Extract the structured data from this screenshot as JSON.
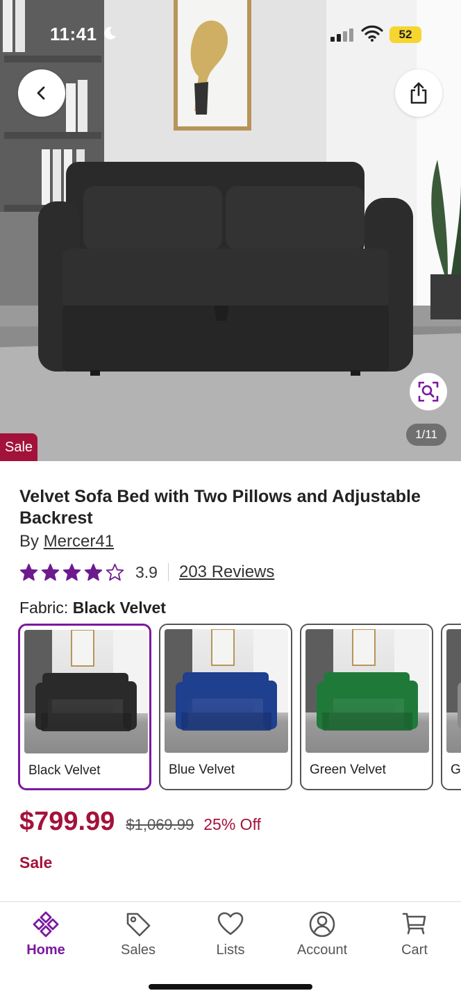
{
  "status_bar": {
    "time": "11:41",
    "battery": "52"
  },
  "hero": {
    "image_counter": "1/11",
    "sale_badge": "Sale"
  },
  "product": {
    "title": "Velvet Sofa Bed with Two Pillows and Adjustable Backrest",
    "by_prefix": "By",
    "brand": "Mercer41",
    "rating": 3.9,
    "rating_text": "3.9",
    "stars_filled": 4,
    "stars_total": 5,
    "reviews_link": "203 Reviews"
  },
  "fabric": {
    "label": "Fabric:",
    "selected": "Black Velvet",
    "options": [
      {
        "label": "Black Velvet",
        "color": "#2a2a2a"
      },
      {
        "label": "Blue Velvet",
        "color": "#1f3f8f"
      },
      {
        "label": "Green Velvet",
        "color": "#1f7a3a"
      },
      {
        "label": "G",
        "color": "#8a8a8a"
      }
    ]
  },
  "pricing": {
    "price": "$799.99",
    "was_price": "$1,069.99",
    "discount": "25% Off",
    "sale_label": "Sale"
  },
  "bottom_nav": [
    {
      "label": "Home",
      "icon": "home-icon",
      "active": true
    },
    {
      "label": "Sales",
      "icon": "tag-icon",
      "active": false
    },
    {
      "label": "Lists",
      "icon": "heart-icon",
      "active": false
    },
    {
      "label": "Account",
      "icon": "account-icon",
      "active": false
    },
    {
      "label": "Cart",
      "icon": "cart-icon",
      "active": false
    }
  ],
  "colors": {
    "brand_purple": "#7b189f",
    "sale_red": "#a3123a",
    "star_purple": "#6d1a8f"
  }
}
